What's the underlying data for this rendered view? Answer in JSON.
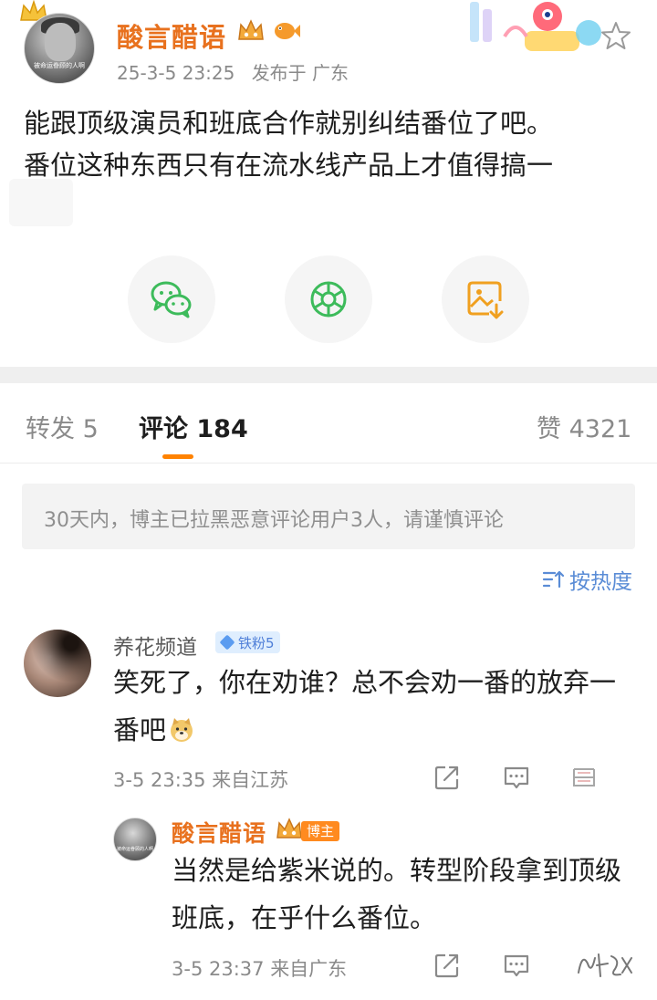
{
  "post": {
    "author": "酸言醋语",
    "time": "25-3-5 23:25",
    "published_at": "发布于 广东",
    "text_lines": [
      "能跟顶级演员和班底合作就别纠结番位了吧。",
      "番位这种东西只有在流水线产品上才值得搞一"
    ],
    "avatar_caption": "被命运眷顾的人啊"
  },
  "share": {
    "icons": [
      "wechat-icon",
      "moments-icon",
      "save-image-icon"
    ],
    "accent_colors": {
      "wechat": "#3dbb5b",
      "moments": "#3dbb5b",
      "save_image": "#f0a020"
    }
  },
  "tabs": {
    "repost": "转发 5",
    "comments": "评论 184",
    "likes": "赞 4321"
  },
  "notice": "30天内，博主已拉黑恶意评论用户3人，请谨慎评论",
  "sort_label": "按热度",
  "comments": [
    {
      "author": "养花频道",
      "fan_badge": "铁粉5",
      "text": "笑死了，你在劝谁？总不会劝一番的放弃一番吧",
      "time": "3-5 23:35",
      "location": "来自江苏",
      "replies": [
        {
          "author": "酸言醋语",
          "badge": "博主",
          "avatar_caption": "被命运眷顾的人啊",
          "text": "当然是给紫米说的。转型阶段拿到顶级班底，在乎什么番位。",
          "time": "3-5 23:37",
          "location": "来自广东"
        }
      ]
    }
  ],
  "colors": {
    "author": "#e8711e",
    "tab_indicator": "#ff8200",
    "sort": "#5a8cd6",
    "op_badge": "#ff8a1f"
  }
}
